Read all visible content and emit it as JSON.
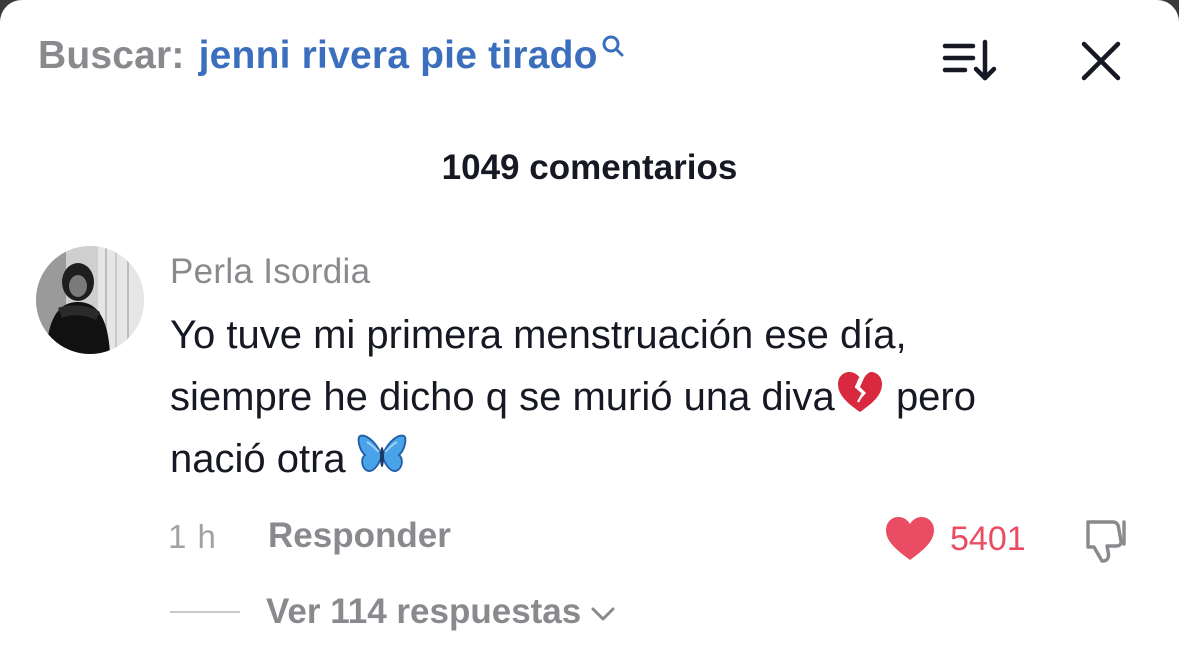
{
  "search": {
    "prefix": "Buscar:",
    "query": "jenni rivera pie tirado"
  },
  "header": {
    "sort_icon": "sort-descending-icon",
    "close_icon": "close-icon"
  },
  "comments": {
    "count_label": "1049 comentarios"
  },
  "comment": {
    "author": "Perla Isordia",
    "avatar": "user-avatar",
    "lines": [
      "Yo tuve mi primera menstruación ese día,",
      "siempre he dicho q se murió una diva",
      "pero",
      "nació otra"
    ],
    "emojis": [
      "broken-heart",
      "blue-butterfly"
    ],
    "timestamp": "1 h",
    "reply_label": "Responder",
    "likes": "5401",
    "view_replies_label": "Ver 114 respuestas"
  },
  "colors": {
    "search_query": "#3b6fbe",
    "like_heart": "#ea4d63",
    "secondary_text": "#8a8a8e",
    "primary_text": "#161823"
  }
}
